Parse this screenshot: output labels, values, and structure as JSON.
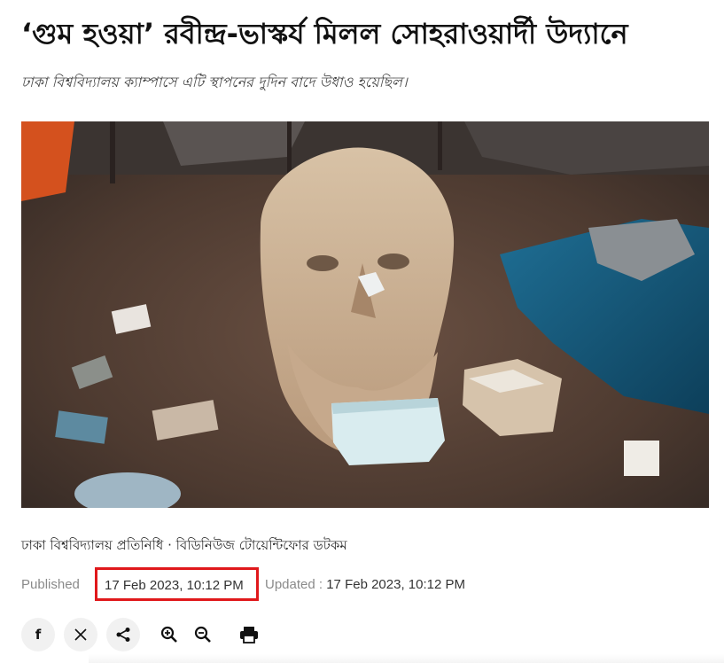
{
  "article": {
    "headline": "‘গুম হওয়া’ রবীন্দ্র-ভাস্কর্য মিলল সোহরাওয়ার্দী উদ্যানে",
    "subheadline": "ঢাকা বিশ্ববিদ্যালয় ক্যাম্পাসে এটি স্থাপনের দুদিন বাদে উধাও হয়েছিল।",
    "byline": "ঢাকা বিশ্ববিদ্যালয় প্রতিনিধি · বিডিনিউজ টোয়েন্টিফোর ডটকম",
    "published_label": "Published",
    "published_value": "17 Feb 2023, 10:12 PM",
    "updated_label": "Updated :",
    "updated_value": "17 Feb 2023, 10:12 PM"
  },
  "share_bar": {
    "facebook_icon": "facebook-icon",
    "x_icon": "x-icon",
    "share_icon": "share-icon",
    "zoom_in_icon": "zoom-in-icon",
    "zoom_out_icon": "zoom-out-icon",
    "print_icon": "print-icon"
  },
  "colors": {
    "highlight_box": "#e0181b",
    "meta_text": "#8a8a8a",
    "button_bg": "#f1f1f1"
  }
}
